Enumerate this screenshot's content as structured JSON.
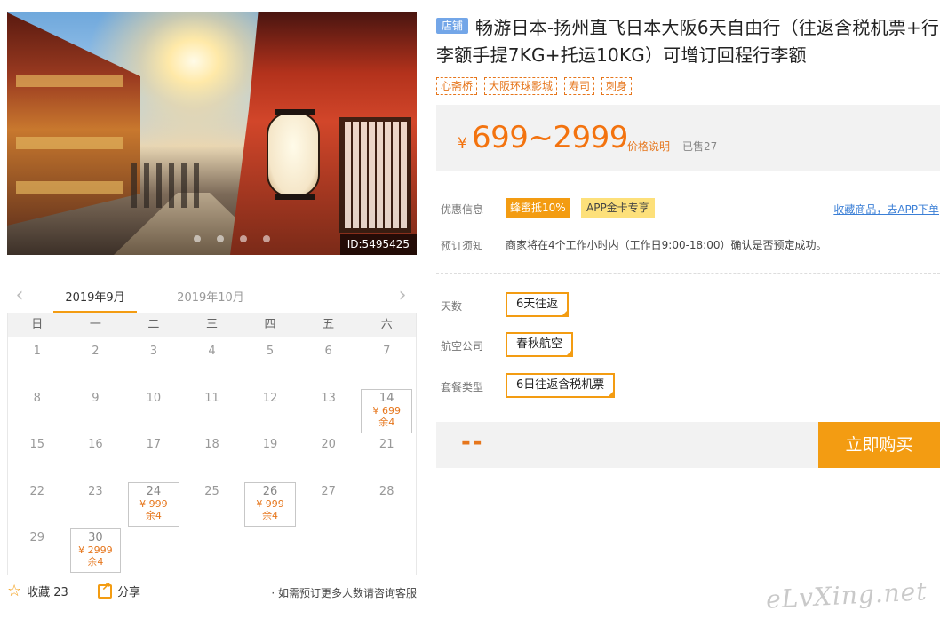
{
  "hero": {
    "image_id": "ID:5495425"
  },
  "calendar": {
    "tabs": [
      "2019年9月",
      "2019年10月"
    ],
    "weekdays": [
      "日",
      "一",
      "二",
      "三",
      "四",
      "五",
      "六"
    ],
    "days": {
      "1": "1",
      "2": "2",
      "3": "3",
      "4": "4",
      "5": "5",
      "6": "6",
      "7": "7",
      "8": "8",
      "9": "9",
      "10": "10",
      "11": "11",
      "12": "12",
      "13": "13",
      "14": {
        "day": "14",
        "price": "¥ 699",
        "remain": "余4"
      },
      "15": "15",
      "16": "16",
      "17": "17",
      "18": "18",
      "19": "19",
      "20": "20",
      "21": "21",
      "22": "22",
      "23": "23",
      "24": {
        "day": "24",
        "price": "¥ 999",
        "remain": "余4"
      },
      "25": "25",
      "26": {
        "day": "26",
        "price": "¥ 999",
        "remain": "余4"
      },
      "27": "27",
      "28": "28",
      "29": "29",
      "30": {
        "day": "30",
        "price": "¥ 2999",
        "remain": "余4"
      }
    }
  },
  "actions": {
    "favorite": "收藏 23",
    "share": "分享",
    "note": "· 如需预订更多人数请咨询客服"
  },
  "product": {
    "shop_tag": "店铺",
    "title": "畅游日本-扬州直飞日本大阪6天自由行（往返含税机票+行李额手提7KG+托运10KG）可增订回程行李额",
    "tags": [
      "心斋桥",
      "大阪环球影城",
      "寿司",
      "刺身"
    ],
    "price_symbol": "¥",
    "price": "699~2999",
    "price_explain": "价格说明",
    "sold": "已售27",
    "promo_label": "优惠信息",
    "promo_1": "蜂蜜抵10%",
    "promo_2": "APP金卡专享",
    "app_link": "收藏商品，去APP下单",
    "notice_label": "预订须知",
    "notice_text": "商家将在4个工作小时内（工作日9:00-18:00）确认是否预定成功。",
    "options": [
      {
        "label": "天数",
        "value": "6天往返"
      },
      {
        "label": "航空公司",
        "value": "春秋航空"
      },
      {
        "label": "套餐类型",
        "value": "6日往返含税机票"
      }
    ],
    "total": "--",
    "buy_label": "立即购买"
  },
  "watermark": "eLvXing.net",
  "colors": {
    "accent": "#f39c12",
    "price": "#f3730f",
    "link": "#3b7fd6",
    "shop_tag": "#73a6e8"
  }
}
